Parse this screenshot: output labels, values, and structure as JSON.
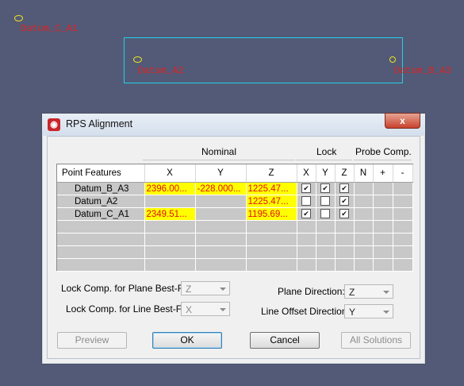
{
  "canvas": {
    "datum_c_a1": "Datum_C_A1",
    "datum_a2": "Datum_A2",
    "datum_b_a3": "Datum_B_A3"
  },
  "dialog": {
    "title": "RPS Alignment",
    "close_label": "x",
    "group_nominal": "Nominal",
    "group_lock": "Lock",
    "group_probe": "Probe Comp.",
    "columns": [
      "Point Features",
      "X",
      "Y",
      "Z",
      "X",
      "Y",
      "Z",
      "N",
      "+",
      "-"
    ],
    "rows": [
      {
        "name": "Datum_B_A3",
        "x": "2396.00...",
        "y": "-228.000...",
        "z": "1225.47...",
        "lock": [
          true,
          true,
          true
        ]
      },
      {
        "name": "Datum_A2",
        "x": "",
        "y": "",
        "z": "1225.47...",
        "lock": [
          false,
          false,
          true
        ]
      },
      {
        "name": "Datum_C_A1",
        "x": "2349.51...",
        "y": "",
        "z": "1195.69...",
        "lock": [
          true,
          false,
          true
        ]
      }
    ],
    "lock_plane_label": "Lock Comp. for Plane Best-Fit:",
    "lock_plane_value": "Z",
    "lock_line_label": "Lock Comp. for Line Best-Fit:",
    "lock_line_value": "X",
    "plane_dir_label": "Plane Direction:",
    "plane_dir_value": "Z",
    "line_offset_label": "Line Offset Direction:",
    "line_offset_value": "Y",
    "buttons": {
      "preview": "Preview",
      "ok": "OK",
      "cancel": "Cancel",
      "all_solutions": "All Solutions"
    }
  },
  "colors": {
    "background": "#535a77",
    "highlight": "#ffff00",
    "value_text": "#e01010",
    "datum_text": "#e02020"
  }
}
